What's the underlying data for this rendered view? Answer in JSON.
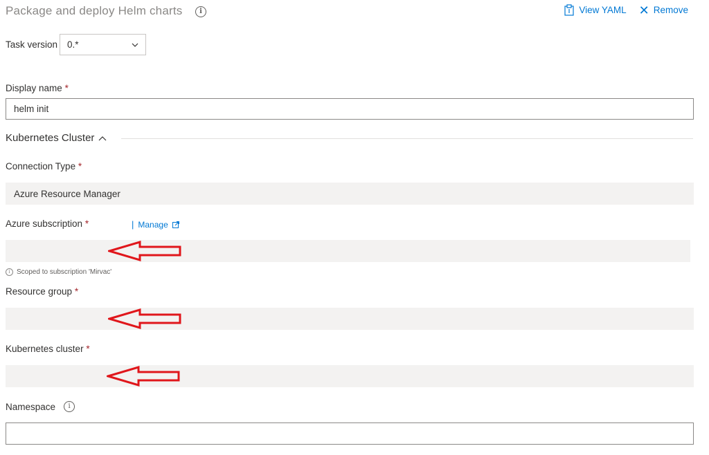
{
  "header": {
    "title": "Package and deploy Helm charts",
    "info_icon": "info-icon",
    "view_yaml_label": "View YAML",
    "remove_label": "Remove"
  },
  "task_version": {
    "label": "Task version",
    "value": "0.*"
  },
  "display_name": {
    "label": "Display name",
    "required": "*",
    "value": "helm init"
  },
  "section": {
    "title": "Kubernetes Cluster"
  },
  "connection_type": {
    "label": "Connection Type",
    "required": "*",
    "value": "Azure Resource Manager"
  },
  "azure_subscription": {
    "label": "Azure subscription",
    "required": "*",
    "manage_separator": "|",
    "manage_label": "Manage",
    "value": "",
    "help_text": "Scoped to subscription 'Mirvac'"
  },
  "resource_group": {
    "label": "Resource group",
    "required": "*",
    "value": ""
  },
  "kubernetes_cluster": {
    "label": "Kubernetes cluster",
    "required": "*",
    "value": ""
  },
  "namespace": {
    "label": "Namespace",
    "value": ""
  },
  "colors": {
    "link": "#0078d4",
    "required": "#a4262c",
    "annotation_arrow": "#e0161b",
    "field_bg": "#f3f2f1"
  }
}
